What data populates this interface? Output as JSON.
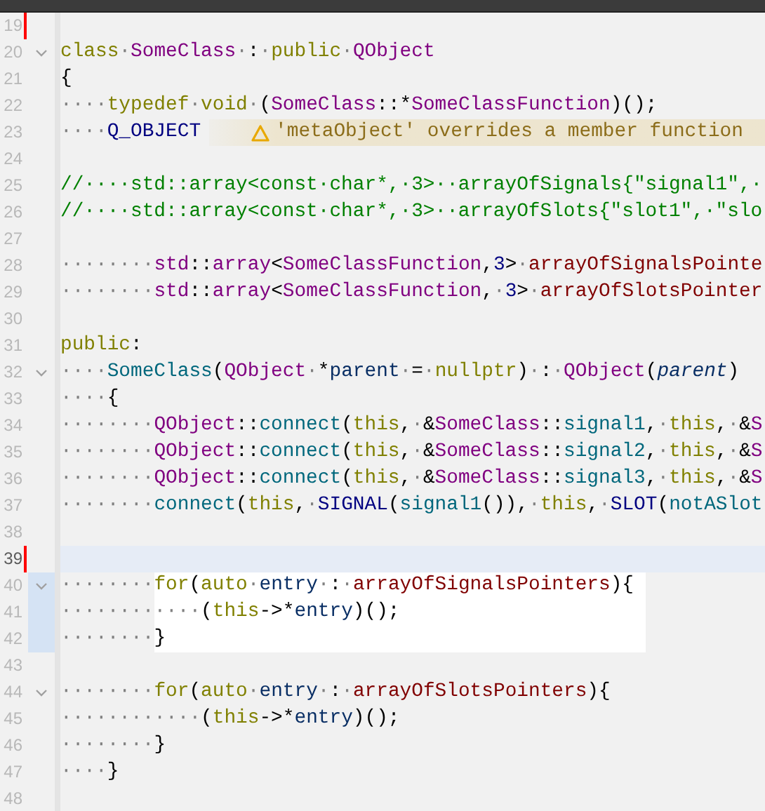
{
  "editor": {
    "lines": [
      {
        "number": "19",
        "changed": true,
        "fold": false,
        "current": false,
        "highlighted": false
      },
      {
        "number": "20",
        "changed": false,
        "fold": true,
        "current": false,
        "highlighted": false,
        "tokens": [
          {
            "text": "class",
            "kind": "kw"
          },
          {
            "text": "·",
            "kind": "ws"
          },
          {
            "text": "SomeClass",
            "kind": "type"
          },
          {
            "text": "·",
            "kind": "ws"
          },
          {
            "text": ":",
            "kind": "p"
          },
          {
            "text": "·",
            "kind": "ws"
          },
          {
            "text": "public",
            "kind": "kw"
          },
          {
            "text": "·",
            "kind": "ws"
          },
          {
            "text": "QObject",
            "kind": "type"
          }
        ]
      },
      {
        "number": "21",
        "changed": false,
        "fold": false,
        "current": false,
        "highlighted": false,
        "tokens": [
          {
            "text": "{",
            "kind": "p"
          }
        ]
      },
      {
        "number": "22",
        "changed": false,
        "fold": false,
        "current": false,
        "highlighted": false,
        "tokens": [
          {
            "text": "····",
            "kind": "ws"
          },
          {
            "text": "typedef",
            "kind": "kw"
          },
          {
            "text": "·",
            "kind": "ws"
          },
          {
            "text": "void",
            "kind": "kw"
          },
          {
            "text": "·",
            "kind": "ws"
          },
          {
            "text": "(",
            "kind": "p"
          },
          {
            "text": "SomeClass",
            "kind": "type"
          },
          {
            "text": "::*",
            "kind": "p"
          },
          {
            "text": "SomeClassFunction",
            "kind": "type"
          },
          {
            "text": ")();",
            "kind": "p"
          }
        ]
      },
      {
        "number": "23",
        "changed": false,
        "fold": false,
        "current": false,
        "highlighted": false,
        "tokens": [
          {
            "text": "····",
            "kind": "ws"
          },
          {
            "text": "Q_OBJECT",
            "kind": "mac"
          }
        ],
        "annotation": {
          "text": "'metaObject' overrides a member function"
        }
      },
      {
        "number": "24",
        "changed": false,
        "fold": false,
        "current": false,
        "highlighted": false
      },
      {
        "number": "25",
        "changed": false,
        "fold": false,
        "current": false,
        "highlighted": false,
        "tokens": [
          {
            "text": "//····std::array<const·char*,·3>··arrayOfSignals{\"signal1\",·",
            "kind": "cm"
          }
        ]
      },
      {
        "number": "26",
        "changed": false,
        "fold": false,
        "current": false,
        "highlighted": false,
        "tokens": [
          {
            "text": "//····std::array<const·char*,·3>··arrayOfSlots{\"slot1\",·\"slo",
            "kind": "cm"
          }
        ]
      },
      {
        "number": "27",
        "changed": false,
        "fold": false,
        "current": false,
        "highlighted": false
      },
      {
        "number": "28",
        "changed": false,
        "fold": false,
        "current": false,
        "highlighted": false,
        "tokens": [
          {
            "text": "········",
            "kind": "ws"
          },
          {
            "text": "std",
            "kind": "type"
          },
          {
            "text": "::",
            "kind": "p"
          },
          {
            "text": "array",
            "kind": "type"
          },
          {
            "text": "<",
            "kind": "p"
          },
          {
            "text": "SomeClassFunction",
            "kind": "type"
          },
          {
            "text": ",",
            "kind": "p"
          },
          {
            "text": "3",
            "kind": "num"
          },
          {
            "text": ">",
            "kind": "p"
          },
          {
            "text": "·",
            "kind": "ws"
          },
          {
            "text": "arrayOfSignalsPointe",
            "kind": "mem"
          }
        ]
      },
      {
        "number": "29",
        "changed": false,
        "fold": false,
        "current": false,
        "highlighted": false,
        "tokens": [
          {
            "text": "········",
            "kind": "ws"
          },
          {
            "text": "std",
            "kind": "type"
          },
          {
            "text": "::",
            "kind": "p"
          },
          {
            "text": "array",
            "kind": "type"
          },
          {
            "text": "<",
            "kind": "p"
          },
          {
            "text": "SomeClassFunction",
            "kind": "type"
          },
          {
            "text": ",",
            "kind": "p"
          },
          {
            "text": "·",
            "kind": "ws"
          },
          {
            "text": "3",
            "kind": "num"
          },
          {
            "text": ">",
            "kind": "p"
          },
          {
            "text": "·",
            "kind": "ws"
          },
          {
            "text": "arrayOfSlotsPointer",
            "kind": "mem"
          }
        ]
      },
      {
        "number": "30",
        "changed": false,
        "fold": false,
        "current": false,
        "highlighted": false
      },
      {
        "number": "31",
        "changed": false,
        "fold": false,
        "current": false,
        "highlighted": false,
        "tokens": [
          {
            "text": "public",
            "kind": "kw"
          },
          {
            "text": ":",
            "kind": "p"
          }
        ]
      },
      {
        "number": "32",
        "changed": false,
        "fold": true,
        "current": false,
        "highlighted": false,
        "tokens": [
          {
            "text": "····",
            "kind": "ws"
          },
          {
            "text": "SomeClass",
            "kind": "fn"
          },
          {
            "text": "(",
            "kind": "p"
          },
          {
            "text": "QObject",
            "kind": "type"
          },
          {
            "text": "·",
            "kind": "ws"
          },
          {
            "text": "*",
            "kind": "p"
          },
          {
            "text": "parent",
            "kind": "var"
          },
          {
            "text": "·",
            "kind": "ws"
          },
          {
            "text": "=",
            "kind": "p"
          },
          {
            "text": "·",
            "kind": "ws"
          },
          {
            "text": "nullptr",
            "kind": "kw"
          },
          {
            "text": ")",
            "kind": "p"
          },
          {
            "text": "·",
            "kind": "ws"
          },
          {
            "text": ":",
            "kind": "p"
          },
          {
            "text": "·",
            "kind": "ws"
          },
          {
            "text": "QObject",
            "kind": "type"
          },
          {
            "text": "(",
            "kind": "p"
          },
          {
            "text": "parent",
            "kind": "param"
          },
          {
            "text": ")",
            "kind": "p"
          }
        ]
      },
      {
        "number": "33",
        "changed": false,
        "fold": false,
        "current": false,
        "highlighted": false,
        "tokens": [
          {
            "text": "····",
            "kind": "ws"
          },
          {
            "text": "{",
            "kind": "p"
          }
        ]
      },
      {
        "number": "34",
        "changed": false,
        "fold": false,
        "current": false,
        "highlighted": false,
        "tokens": [
          {
            "text": "········",
            "kind": "ws"
          },
          {
            "text": "QObject",
            "kind": "type"
          },
          {
            "text": "::",
            "kind": "p"
          },
          {
            "text": "connect",
            "kind": "fn"
          },
          {
            "text": "(",
            "kind": "p"
          },
          {
            "text": "this",
            "kind": "kw"
          },
          {
            "text": ",",
            "kind": "p"
          },
          {
            "text": "·",
            "kind": "ws"
          },
          {
            "text": "&",
            "kind": "p"
          },
          {
            "text": "SomeClass",
            "kind": "type"
          },
          {
            "text": "::",
            "kind": "p"
          },
          {
            "text": "signal1",
            "kind": "fn"
          },
          {
            "text": ",",
            "kind": "p"
          },
          {
            "text": "·",
            "kind": "ws"
          },
          {
            "text": "this",
            "kind": "kw"
          },
          {
            "text": ",",
            "kind": "p"
          },
          {
            "text": "·",
            "kind": "ws"
          },
          {
            "text": "&",
            "kind": "p"
          },
          {
            "text": "S",
            "kind": "type"
          }
        ]
      },
      {
        "number": "35",
        "changed": false,
        "fold": false,
        "current": false,
        "highlighted": false,
        "tokens": [
          {
            "text": "········",
            "kind": "ws"
          },
          {
            "text": "QObject",
            "kind": "type"
          },
          {
            "text": "::",
            "kind": "p"
          },
          {
            "text": "connect",
            "kind": "fn"
          },
          {
            "text": "(",
            "kind": "p"
          },
          {
            "text": "this",
            "kind": "kw"
          },
          {
            "text": ",",
            "kind": "p"
          },
          {
            "text": "·",
            "kind": "ws"
          },
          {
            "text": "&",
            "kind": "p"
          },
          {
            "text": "SomeClass",
            "kind": "type"
          },
          {
            "text": "::",
            "kind": "p"
          },
          {
            "text": "signal2",
            "kind": "fn"
          },
          {
            "text": ",",
            "kind": "p"
          },
          {
            "text": "·",
            "kind": "ws"
          },
          {
            "text": "this",
            "kind": "kw"
          },
          {
            "text": ",",
            "kind": "p"
          },
          {
            "text": "·",
            "kind": "ws"
          },
          {
            "text": "&",
            "kind": "p"
          },
          {
            "text": "S",
            "kind": "type"
          }
        ]
      },
      {
        "number": "36",
        "changed": false,
        "fold": false,
        "current": false,
        "highlighted": false,
        "tokens": [
          {
            "text": "········",
            "kind": "ws"
          },
          {
            "text": "QObject",
            "kind": "type"
          },
          {
            "text": "::",
            "kind": "p"
          },
          {
            "text": "connect",
            "kind": "fn"
          },
          {
            "text": "(",
            "kind": "p"
          },
          {
            "text": "this",
            "kind": "kw"
          },
          {
            "text": ",",
            "kind": "p"
          },
          {
            "text": "·",
            "kind": "ws"
          },
          {
            "text": "&",
            "kind": "p"
          },
          {
            "text": "SomeClass",
            "kind": "type"
          },
          {
            "text": "::",
            "kind": "p"
          },
          {
            "text": "signal3",
            "kind": "fn"
          },
          {
            "text": ",",
            "kind": "p"
          },
          {
            "text": "·",
            "kind": "ws"
          },
          {
            "text": "this",
            "kind": "kw"
          },
          {
            "text": ",",
            "kind": "p"
          },
          {
            "text": "·",
            "kind": "ws"
          },
          {
            "text": "&",
            "kind": "p"
          },
          {
            "text": "S",
            "kind": "type"
          }
        ]
      },
      {
        "number": "37",
        "changed": false,
        "fold": false,
        "current": false,
        "highlighted": false,
        "tokens": [
          {
            "text": "········",
            "kind": "ws"
          },
          {
            "text": "connect",
            "kind": "fn"
          },
          {
            "text": "(",
            "kind": "p"
          },
          {
            "text": "this",
            "kind": "kw"
          },
          {
            "text": ",",
            "kind": "p"
          },
          {
            "text": "·",
            "kind": "ws"
          },
          {
            "text": "SIGNAL",
            "kind": "mac"
          },
          {
            "text": "(",
            "kind": "p"
          },
          {
            "text": "signal1",
            "kind": "fn"
          },
          {
            "text": "())",
            "kind": "p"
          },
          {
            "text": ",",
            "kind": "p"
          },
          {
            "text": "·",
            "kind": "ws"
          },
          {
            "text": "this",
            "kind": "kw"
          },
          {
            "text": ",",
            "kind": "p"
          },
          {
            "text": "·",
            "kind": "ws"
          },
          {
            "text": "SLOT",
            "kind": "mac"
          },
          {
            "text": "(",
            "kind": "p"
          },
          {
            "text": "notASlot",
            "kind": "fn"
          }
        ]
      },
      {
        "number": "38",
        "changed": false,
        "fold": false,
        "current": false,
        "highlighted": false
      },
      {
        "number": "39",
        "changed": true,
        "fold": false,
        "current": true,
        "highlighted": false
      },
      {
        "number": "40",
        "changed": false,
        "fold": true,
        "current": false,
        "highlighted": true,
        "tokens": [
          {
            "text": "········",
            "kind": "ws"
          },
          {
            "text": "for",
            "kind": "kw"
          },
          {
            "text": "(",
            "kind": "p"
          },
          {
            "text": "auto",
            "kind": "kw"
          },
          {
            "text": "·",
            "kind": "ws"
          },
          {
            "text": "entry",
            "kind": "var"
          },
          {
            "text": "·",
            "kind": "ws"
          },
          {
            "text": ":",
            "kind": "p"
          },
          {
            "text": "·",
            "kind": "ws"
          },
          {
            "text": "arrayOfSignalsPointers",
            "kind": "mem"
          },
          {
            "text": "){",
            "kind": "p"
          }
        ]
      },
      {
        "number": "41",
        "changed": false,
        "fold": false,
        "current": false,
        "highlighted": true,
        "tokens": [
          {
            "text": "········",
            "kind": "ws"
          },
          {
            "text": "····",
            "kind": "ws"
          },
          {
            "text": "(",
            "kind": "p"
          },
          {
            "text": "this",
            "kind": "kw"
          },
          {
            "text": "->*",
            "kind": "p"
          },
          {
            "text": "entry",
            "kind": "var"
          },
          {
            "text": ")();",
            "kind": "p"
          }
        ]
      },
      {
        "number": "42",
        "changed": false,
        "fold": false,
        "current": false,
        "highlighted": true,
        "tokens": [
          {
            "text": "········",
            "kind": "ws"
          },
          {
            "text": "}",
            "kind": "p"
          }
        ]
      },
      {
        "number": "43",
        "changed": false,
        "fold": false,
        "current": false,
        "highlighted": false
      },
      {
        "number": "44",
        "changed": false,
        "fold": true,
        "current": false,
        "highlighted": false,
        "tokens": [
          {
            "text": "········",
            "kind": "ws"
          },
          {
            "text": "for",
            "kind": "kw"
          },
          {
            "text": "(",
            "kind": "p"
          },
          {
            "text": "auto",
            "kind": "kw"
          },
          {
            "text": "·",
            "kind": "ws"
          },
          {
            "text": "entry",
            "kind": "var"
          },
          {
            "text": "·",
            "kind": "ws"
          },
          {
            "text": ":",
            "kind": "p"
          },
          {
            "text": "·",
            "kind": "ws"
          },
          {
            "text": "arrayOfSlotsPointers",
            "kind": "mem"
          },
          {
            "text": "){",
            "kind": "p"
          }
        ]
      },
      {
        "number": "45",
        "changed": false,
        "fold": false,
        "current": false,
        "highlighted": false,
        "tokens": [
          {
            "text": "············",
            "kind": "ws"
          },
          {
            "text": "(",
            "kind": "p"
          },
          {
            "text": "this",
            "kind": "kw"
          },
          {
            "text": "->*",
            "kind": "p"
          },
          {
            "text": "entry",
            "kind": "var"
          },
          {
            "text": ")();",
            "kind": "p"
          }
        ]
      },
      {
        "number": "46",
        "changed": false,
        "fold": false,
        "current": false,
        "highlighted": false,
        "tokens": [
          {
            "text": "········",
            "kind": "ws"
          },
          {
            "text": "}",
            "kind": "p"
          }
        ]
      },
      {
        "number": "47",
        "changed": false,
        "fold": false,
        "current": false,
        "highlighted": false,
        "tokens": [
          {
            "text": "····",
            "kind": "ws"
          },
          {
            "text": "}",
            "kind": "p"
          }
        ]
      },
      {
        "number": "48",
        "changed": false,
        "fold": false,
        "current": false,
        "highlighted": false
      }
    ]
  }
}
